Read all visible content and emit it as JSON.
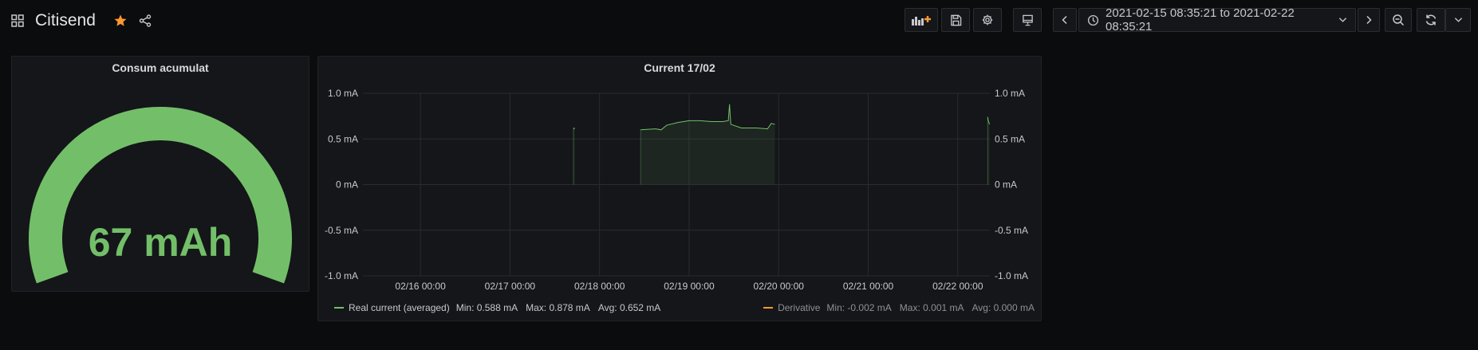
{
  "header": {
    "title": "Citisend",
    "time_range": "2021-02-15 08:35:21 to 2021-02-22 08:35:21"
  },
  "colors": {
    "accent_star": "#ff9830",
    "series_green": "#73bf69",
    "series_orange": "#ff9830"
  },
  "icons": {
    "apps": "apps-icon",
    "star": "star-icon",
    "share": "share-icon",
    "add_panel": "add-panel-icon",
    "save": "save-icon",
    "settings": "gear-icon",
    "tv": "monitor-icon",
    "back": "chevron-left-icon",
    "clock": "clock-icon",
    "caret": "chevron-down-icon",
    "forward": "chevron-right-icon",
    "zoom_out": "zoom-out-icon",
    "refresh": "refresh-icon",
    "refresh_caret": "chevron-down-icon"
  },
  "gauge_panel": {
    "title": "Consum acumulat",
    "value_text": "67 mAh",
    "fill_fraction": 1.0
  },
  "graph_panel": {
    "title": "Current 17/02",
    "legend": [
      {
        "name": "Real current (averaged)",
        "min": "Min: 0.588 mA",
        "max": "Max: 0.878 mA",
        "avg": "Avg: 0.652 mA"
      },
      {
        "name": "Derivative",
        "min": "Min: -0.002 mA",
        "max": "Max: 0.001 mA",
        "avg": "Avg: 0.000 mA"
      }
    ]
  },
  "chart_data": {
    "type": "line",
    "y_ticks": [
      "1.0 mA",
      "0.5 mA",
      "0 mA",
      "-0.5 mA",
      "-1.0 mA"
    ],
    "y_tick_values": [
      1.0,
      0.5,
      0,
      -0.5,
      -1.0
    ],
    "ylim": [
      -1.0,
      1.0
    ],
    "x_ticks": [
      "02/16 00:00",
      "02/17 00:00",
      "02/18 00:00",
      "02/19 00:00",
      "02/20 00:00",
      "02/21 00:00",
      "02/22 00:00"
    ],
    "x_tick_values": [
      "2021-02-16 00:00",
      "2021-02-17 00:00",
      "2021-02-18 00:00",
      "2021-02-19 00:00",
      "2021-02-20 00:00",
      "2021-02-21 00:00",
      "2021-02-22 00:00"
    ],
    "xlim": [
      "2021-02-15 08:35:21",
      "2021-02-22 08:35:21"
    ],
    "grid": true,
    "legend_placement": "bottom",
    "series": [
      {
        "name": "Real current (averaged)",
        "color": "#73bf69",
        "fill": true,
        "segments": [
          [
            [
              "2021-02-17 17:00",
              0.62
            ],
            [
              "2021-02-17 17:10",
              0.61
            ],
            [
              "2021-02-17 17:20",
              0.62
            ]
          ],
          [
            [
              "2021-02-18 11:00",
              0.6
            ],
            [
              "2021-02-18 15:00",
              0.61
            ],
            [
              "2021-02-18 16:30",
              0.6
            ],
            [
              "2021-02-18 18:00",
              0.65
            ],
            [
              "2021-02-18 21:00",
              0.68
            ],
            [
              "2021-02-19 00:00",
              0.7
            ],
            [
              "2021-02-19 03:00",
              0.7
            ],
            [
              "2021-02-19 06:00",
              0.69
            ],
            [
              "2021-02-19 09:00",
              0.69
            ],
            [
              "2021-02-19 10:30",
              0.7
            ],
            [
              "2021-02-19 10:50",
              0.88
            ],
            [
              "2021-02-19 11:10",
              0.66
            ],
            [
              "2021-02-19 14:00",
              0.62
            ],
            [
              "2021-02-19 18:00",
              0.62
            ],
            [
              "2021-02-19 21:00",
              0.61
            ],
            [
              "2021-02-19 22:00",
              0.67
            ],
            [
              "2021-02-19 23:00",
              0.66
            ]
          ],
          [
            [
              "2021-02-22 08:00",
              0.74
            ],
            [
              "2021-02-22 08:10",
              0.7
            ],
            [
              "2021-02-22 08:20",
              0.68
            ],
            [
              "2021-02-22 08:30",
              0.66
            ]
          ]
        ]
      },
      {
        "name": "Derivative",
        "color": "#ff9830",
        "fill": false,
        "segments": []
      }
    ]
  }
}
